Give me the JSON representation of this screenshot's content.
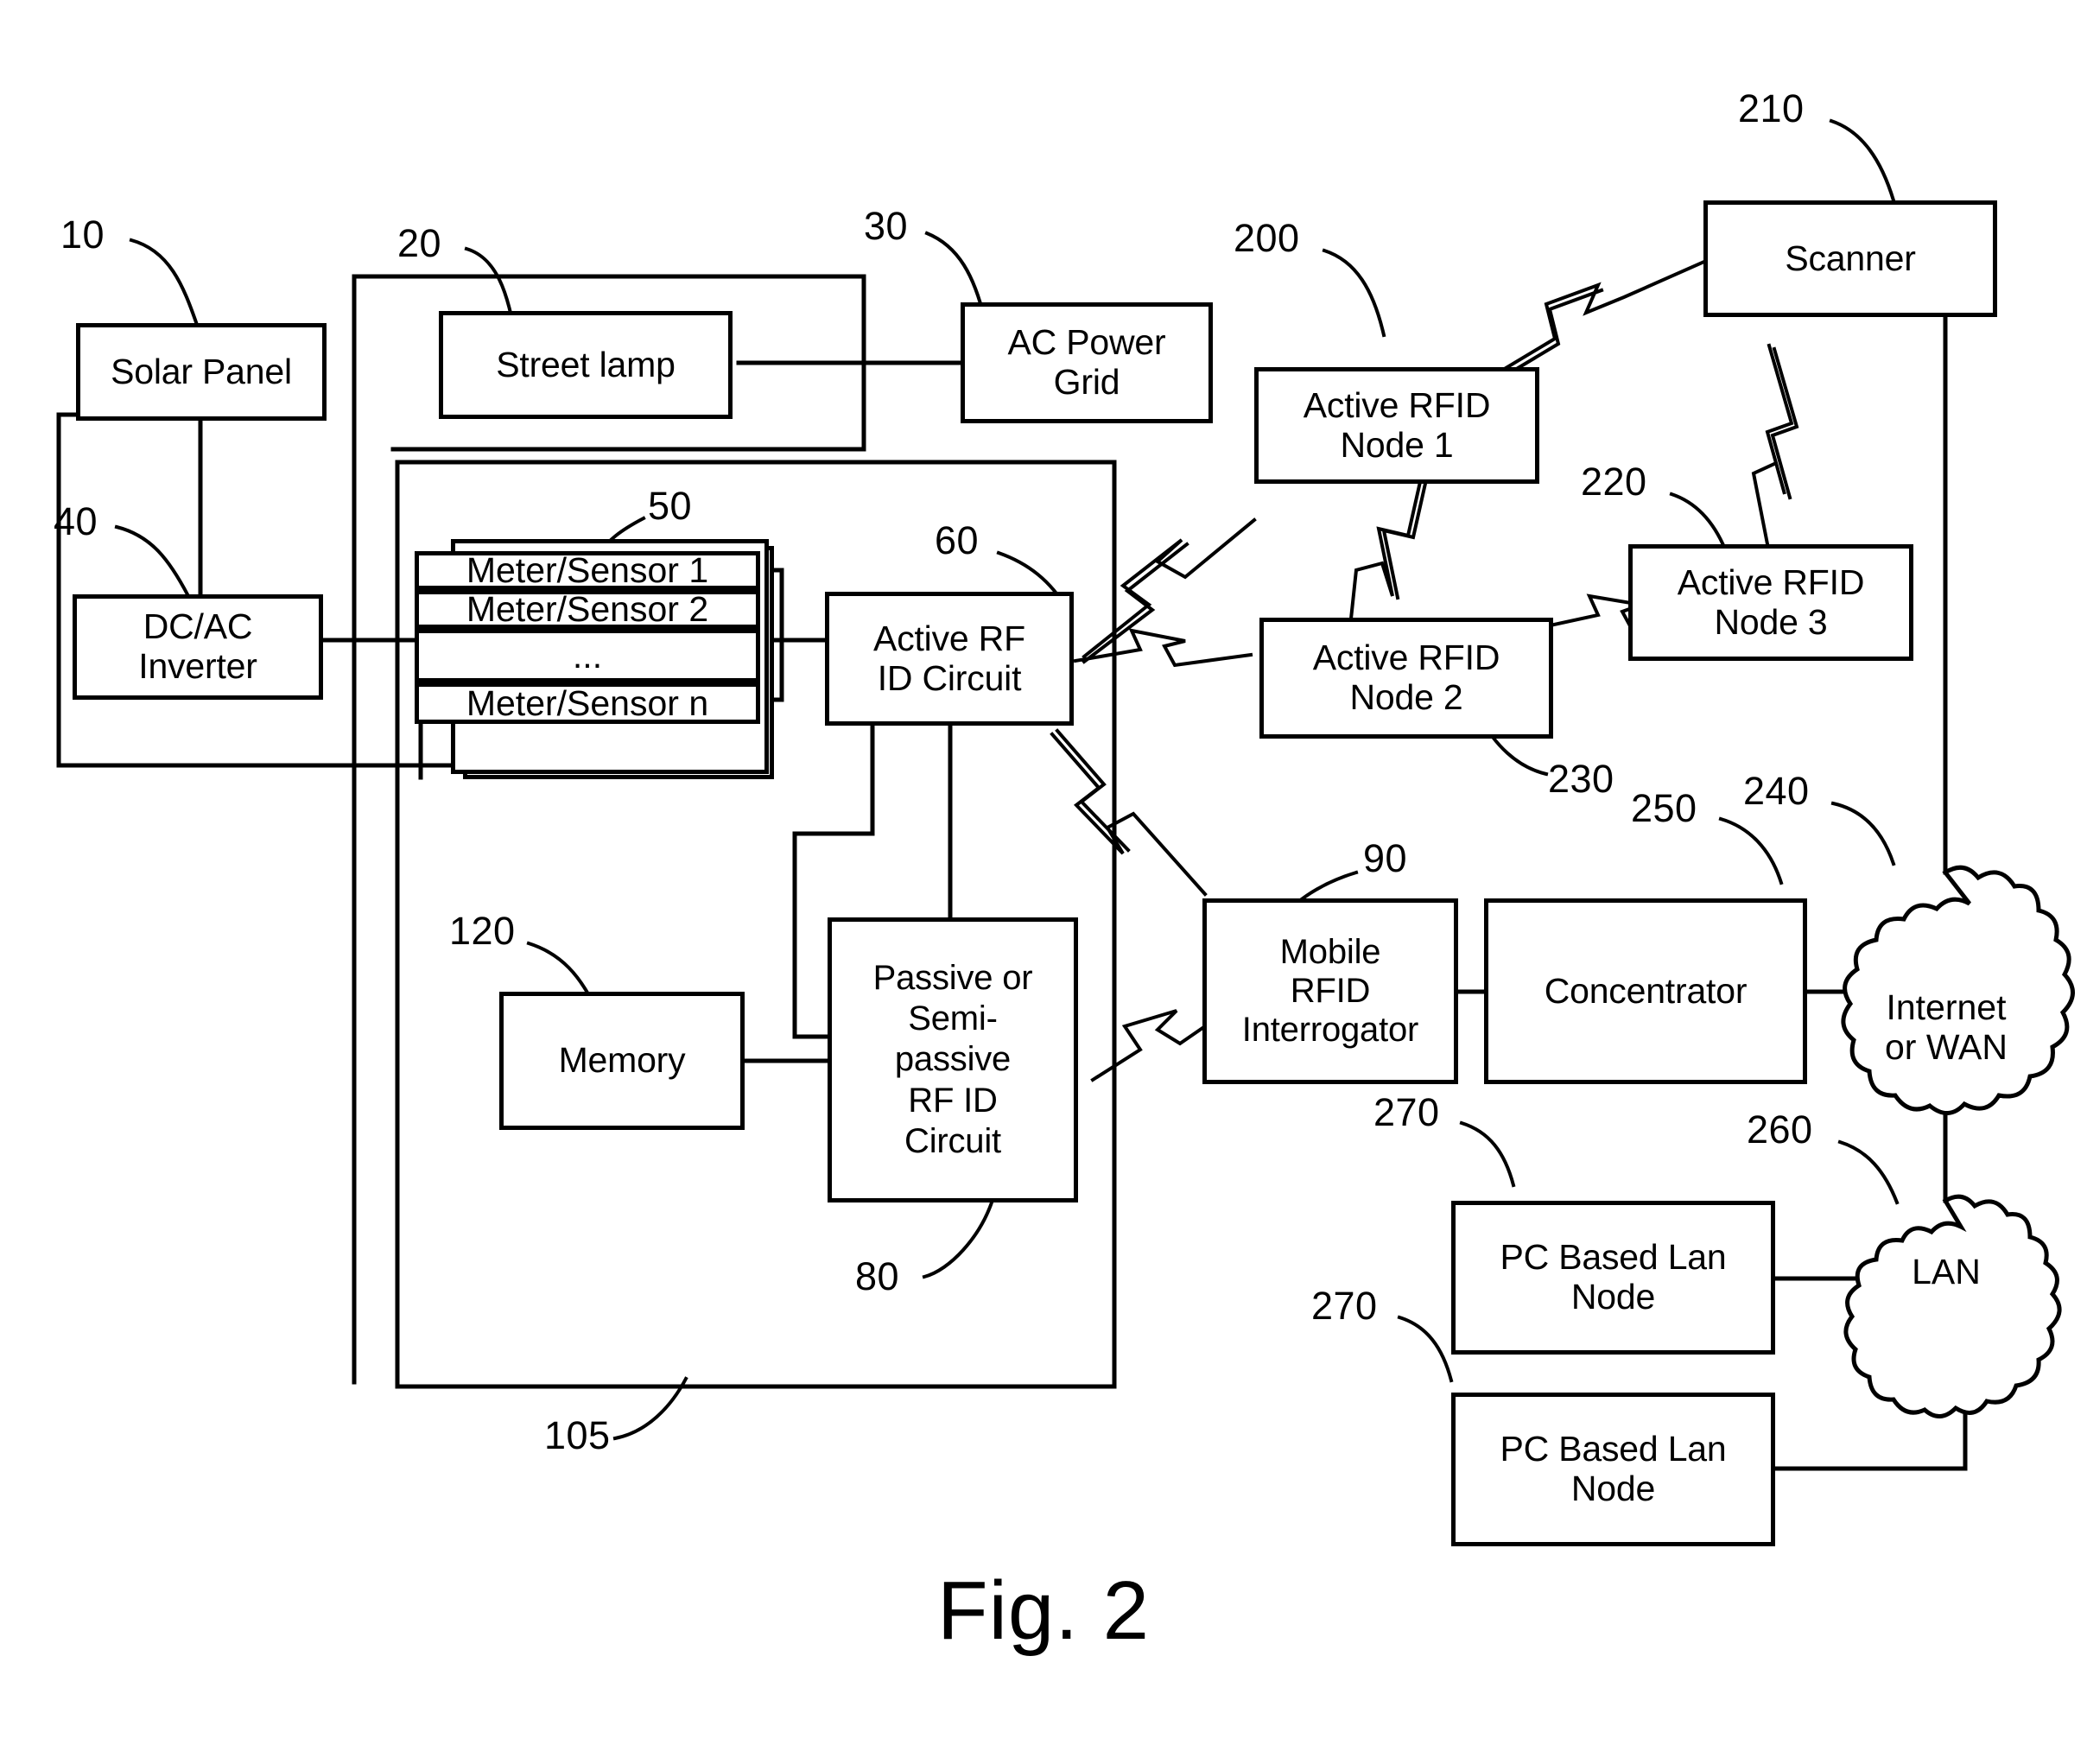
{
  "figure": {
    "caption": "Fig. 2"
  },
  "nodes": {
    "solar_panel": "Solar Panel",
    "street_lamp": "Street lamp",
    "ac_power_grid": "AC Power\nGrid",
    "dc_ac_inverter": "DC/AC\nInverter",
    "meter_sensor_1": "Meter/Sensor 1",
    "meter_sensor_2": "Meter/Sensor 2",
    "meter_sensor_ellipsis": "...",
    "meter_sensor_n": "Meter/Sensor n",
    "active_rf_id_circuit": "Active RF\nID Circuit",
    "memory": "Memory",
    "passive_rf_id_circuit": "Passive or\nSemi-\npassive\nRF ID\nCircuit",
    "active_rfid_node_1": "Active RFID\nNode 1",
    "active_rfid_node_2": "Active RFID\nNode 2",
    "active_rfid_node_3": "Active RFID\nNode 3",
    "scanner": "Scanner",
    "mobile_rfid_interrogator": "Mobile\nRFID\nInterrogator",
    "concentrator": "Concentrator",
    "internet_or_wan": "Internet\nor WAN",
    "lan": "LAN",
    "pc_based_lan_node_1": "PC Based Lan\nNode",
    "pc_based_lan_node_2": "PC Based Lan\nNode"
  },
  "reference_numerals": {
    "solar_panel": "10",
    "street_lamp": "20",
    "ac_power_grid": "30",
    "dc_ac_inverter": "40",
    "meter_sensor_group": "50",
    "active_rf_id_circuit": "60",
    "passive_rf_id_circuit": "80",
    "mobile_rfid_interrogator": "90",
    "device_enclosure": "105",
    "memory": "120",
    "active_rfid_node_1": "200",
    "scanner": "210",
    "active_rfid_node_3": "220",
    "active_rfid_node_2": "230",
    "internet_or_wan": "240",
    "concentrator": "250",
    "lan": "260",
    "pc_based_lan_node_1": "270",
    "pc_based_lan_node_2": "270"
  },
  "colors": {
    "line": "#000000",
    "background": "#ffffff"
  }
}
